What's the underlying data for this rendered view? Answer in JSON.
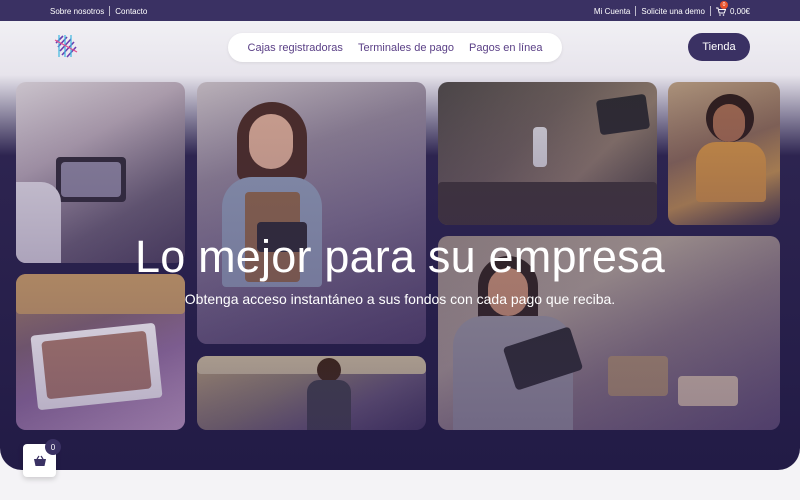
{
  "topbar": {
    "about": "Sobre nosotros",
    "contact": "Contacto",
    "account": "Mi Cuenta",
    "demo": "Solicite una demo",
    "cart_count": "0",
    "cart_total": "0,00€"
  },
  "nav": {
    "items": [
      "Cajas registradoras",
      "Terminales de pago",
      "Pagos en línea"
    ],
    "shop_button": "Tienda"
  },
  "hero": {
    "title": "Lo mejor para su empresa",
    "subtitle": "Obtenga acceso instantáneo a sus fondos con cada pago que reciba."
  },
  "floating_cart": {
    "count": "0"
  },
  "colors": {
    "brand_dark": "#3a3163",
    "nav_text": "#5a3f86",
    "badge": "#e8512b"
  },
  "icons": [
    "logo-icon",
    "cart-icon",
    "basket-icon"
  ]
}
